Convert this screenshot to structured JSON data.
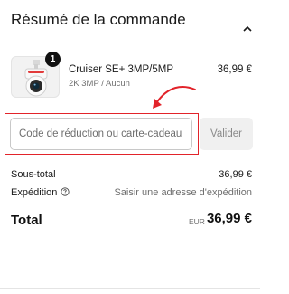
{
  "order_summary": {
    "title": "Résumé de la commande",
    "collapse_icon": "chevron-up-icon"
  },
  "line_item": {
    "image_icon": "security-camera-icon",
    "quantity": "1",
    "name": "Cruiser SE+ 3MP/5MP",
    "variant": "2K 3MP / Aucun",
    "price": "36,99 €"
  },
  "discount": {
    "placeholder": "Code de réduction ou carte-cadeau",
    "value": "",
    "apply_label": "Valider",
    "annotation_color": "#e2232a"
  },
  "totals": {
    "subtotal_label": "Sous-total",
    "subtotal_value": "36,99 €",
    "shipping_label": "Expédition",
    "shipping_help_icon": "question-circle-icon",
    "shipping_value": "Saisir une adresse d'expédition",
    "total_label": "Total",
    "currency": "EUR",
    "total_value": "36,99 €"
  }
}
